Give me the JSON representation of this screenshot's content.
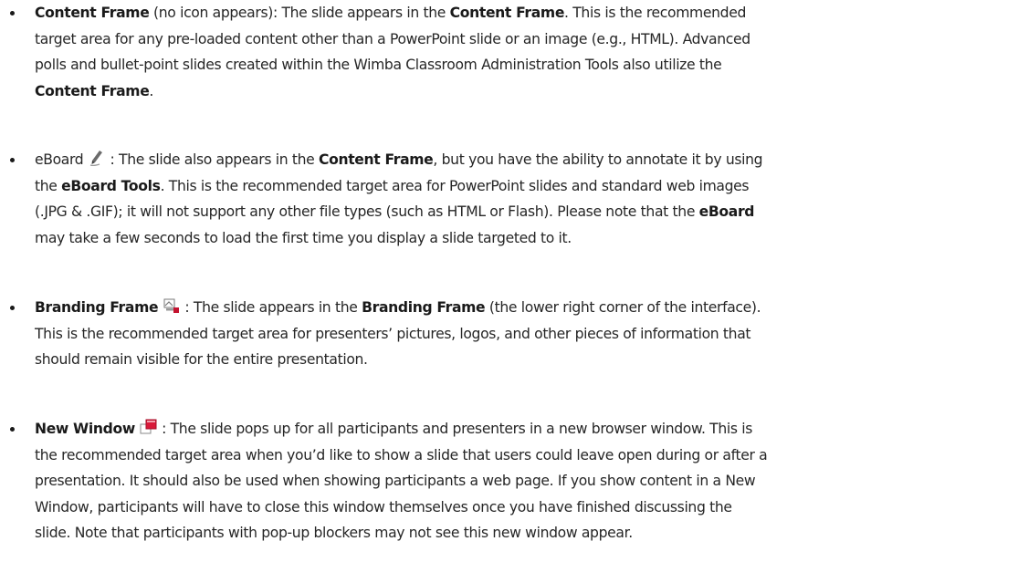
{
  "icons": {
    "eboard": "pencil-icon",
    "branding": "branding-frame-icon",
    "new_window": "new-window-icon"
  },
  "colors": {
    "text": "#262626",
    "icon_red": "#c4122f"
  },
  "items": [
    {
      "lines": [
        [
          "Content Frame",
          " (no icon appears): The slide appears in the ",
          "Content Frame",
          ".  This is the recommended"
        ],
        [
          "target area for any pre-loaded content other than a PowerPoint slide or an image (e.g., HTML). Advanced"
        ],
        [
          "polls and bullet-point slides created  within the Wimba Classroom Administration Tools also utilize the"
        ],
        [
          "Content Frame",
          "."
        ]
      ]
    },
    {
      "lines": [
        [
          "eBoard ",
          " : The slide also appears in the ",
          "Content Frame",
          ", but you have the ability to annotate it by using"
        ],
        [
          "the ",
          "eBoard Tools",
          ". This is the recommended target area for PowerPoint slides and standard web images"
        ],
        [
          "(.JPG & .GIF); it will not support any other file types (such as HTML or Flash). Please note that the ",
          "eBoard"
        ],
        [
          "may take a few seconds to load the first time you display a slide targeted to it."
        ]
      ]
    },
    {
      "lines": [
        [
          "Branding Frame",
          " : The slide appears in the ",
          "Branding Frame",
          " (the lower right corner of the interface)."
        ],
        [
          "This is the recommended target area for presenters’ pictures, logos, and other pieces of information that"
        ],
        [
          "should remain visible for the entire presentation."
        ]
      ]
    },
    {
      "lines": [
        [
          "New Window",
          " : The slide pops up for all participants and presenters in a new browser window. This is"
        ],
        [
          "the recommended target area when you’d like to show a slide that users could leave open during or after a"
        ],
        [
          "presentation. It should also be used when showing participants a web page. If you show content in a New"
        ],
        [
          "Window, participants will have to close this window themselves once you have finished discussing the"
        ],
        [
          "slide. Note that participants with pop-up blockers may not see this new window appear."
        ]
      ]
    }
  ]
}
